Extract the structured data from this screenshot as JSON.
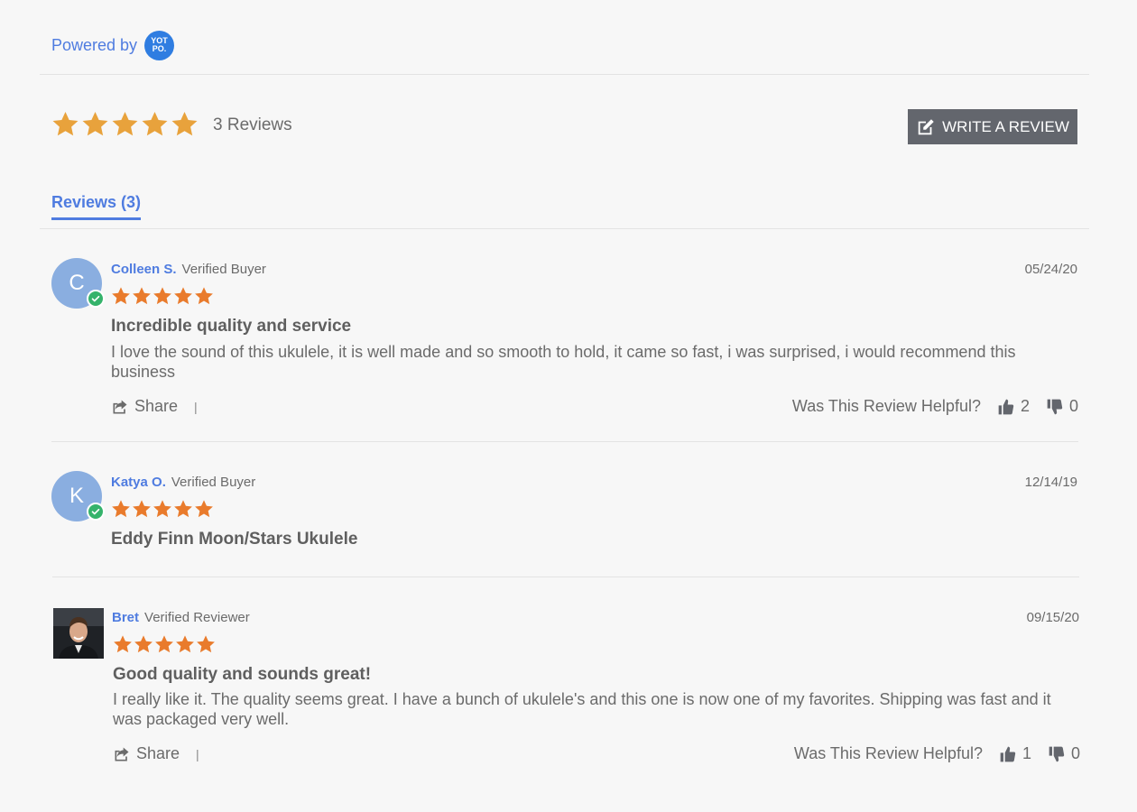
{
  "header": {
    "powered_by": "Powered by",
    "logo_text": "YOT PO.",
    "review_count": "3 Reviews",
    "write_review": "WRITE A REVIEW",
    "average_rating": 5
  },
  "tabs": [
    {
      "label": "Reviews (3)",
      "active": true
    }
  ],
  "colors": {
    "accent": "#4f7ce0",
    "star": "#e8a23c",
    "review_star": "#e97b2c",
    "button": "#63666d",
    "verified": "#35b36b",
    "avatar": "#8aaee0"
  },
  "reviews": [
    {
      "initial": "C",
      "name": "Colleen S.",
      "badge": "Verified Buyer",
      "date": "05/24/20",
      "rating": 5,
      "title": "Incredible quality and service",
      "body": "I love the sound of this ukulele, it is well made and so smooth to hold, it came so fast, i was surprised, i would recommend this business",
      "share": "Share",
      "helpful_label": "Was This Review Helpful?",
      "up": "2",
      "down": "0"
    },
    {
      "initial": "K",
      "name": "Katya O.",
      "badge": "Verified Buyer",
      "date": "12/14/19",
      "rating": 5,
      "title": "Eddy Finn Moon/Stars Ukulele"
    },
    {
      "name": "Bret",
      "badge": "Verified Reviewer",
      "date": "09/15/20",
      "rating": 5,
      "title": "Good quality and sounds great!",
      "body": "I really like it. The quality seems great. I have a bunch of ukulele's and this one is now one of my favorites. Shipping was fast and it was packaged very well.",
      "share": "Share",
      "helpful_label": "Was This Review Helpful?",
      "up": "1",
      "down": "0"
    }
  ]
}
